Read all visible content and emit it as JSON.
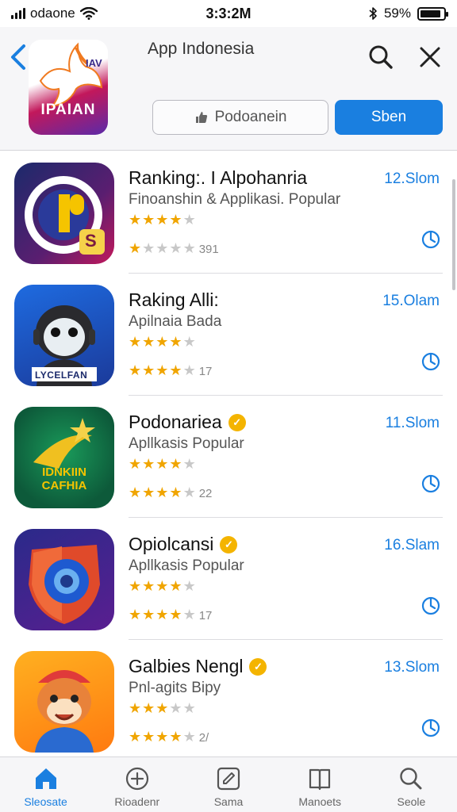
{
  "status_bar": {
    "carrier": "odaone",
    "time": "3:3:2M",
    "battery": "59%",
    "battery_level": 0.9
  },
  "header": {
    "logo_text": "IPAIAN",
    "title": "App Indonesia",
    "download_label": "Podoanein",
    "open_label": "Sben",
    "icons": [
      "back-chevron-icon",
      "search-icon",
      "close-icon"
    ]
  },
  "apps": [
    {
      "name": "Ranking:. I Alpohanria",
      "subtitle": "Finoanshin & Applikasi. Popular",
      "size": "12.Slom",
      "rating1": 4,
      "rating2": 1,
      "rating_count": "391",
      "verified": false,
      "icon_text": "S"
    },
    {
      "name": "Raking Alli:",
      "subtitle": "Apilnaia Bada",
      "size": "15.Olam",
      "rating1": 4,
      "rating2": 4,
      "rating_count": "17",
      "verified": false,
      "icon_text": "LYCELFAN"
    },
    {
      "name": "Podonariea",
      "subtitle": "Apllkasis Popular",
      "size": "11.Slom",
      "rating1": 4,
      "rating2": 4,
      "rating_count": "22",
      "verified": true,
      "icon_text": "IDNKIIN CAFHIA"
    },
    {
      "name": "Opiolcansi",
      "subtitle": "Apllkasis Popular",
      "size": "16.Slam",
      "rating1": 4,
      "rating2": 4,
      "rating_count": "17",
      "verified": true,
      "icon_text": ""
    },
    {
      "name": "Galbies Nengl",
      "subtitle": "Pnl-agits Bipy",
      "size": "13.Slom",
      "rating1": 3,
      "rating2": 4,
      "rating_count": "2/",
      "verified": true,
      "icon_text": ""
    }
  ],
  "tabs": [
    {
      "label": "Sleosate",
      "icon": "home-icon",
      "active": true
    },
    {
      "label": "Rioadenr",
      "icon": "compass-plus-icon",
      "active": false
    },
    {
      "label": "Sama",
      "icon": "edit-icon",
      "active": false
    },
    {
      "label": "Manoets",
      "icon": "book-icon",
      "active": false
    },
    {
      "label": "Seole",
      "icon": "search-icon",
      "active": false
    }
  ],
  "colors": {
    "accent": "#1a7fe0",
    "star": "#f0a500",
    "verified": "#f4b400"
  }
}
